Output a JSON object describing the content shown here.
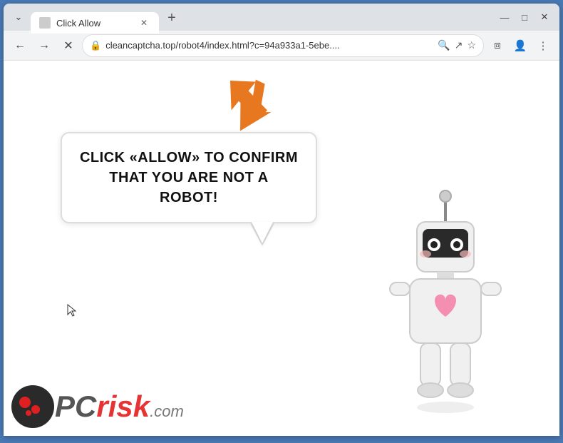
{
  "browser": {
    "tab": {
      "title": "Click Allow",
      "favicon_label": "tab-favicon"
    },
    "new_tab_label": "+",
    "window_controls": {
      "minimize": "—",
      "maximize": "□",
      "close": "✕",
      "chevron": "⌄"
    },
    "toolbar": {
      "back_label": "←",
      "forward_label": "→",
      "reload_label": "✕",
      "address": "cleancaptcha.top/robot4/index.html?c=94a933a1-5ebe....",
      "lock_label": "🔒",
      "search_label": "🔍",
      "share_label": "↗",
      "bookmark_label": "☆",
      "extensions_label": "⧈",
      "profile_label": "👤",
      "menu_label": "⋮"
    }
  },
  "page": {
    "bubble_text": "CLICK «ALLOW» TO CONFIRM THAT YOU ARE NOT A ROBOT!",
    "arrow_label": "orange-arrow",
    "robot_label": "robot-image"
  },
  "logo": {
    "pc_text": "PC",
    "risk_text": "risk",
    "dot_com": ".com"
  }
}
